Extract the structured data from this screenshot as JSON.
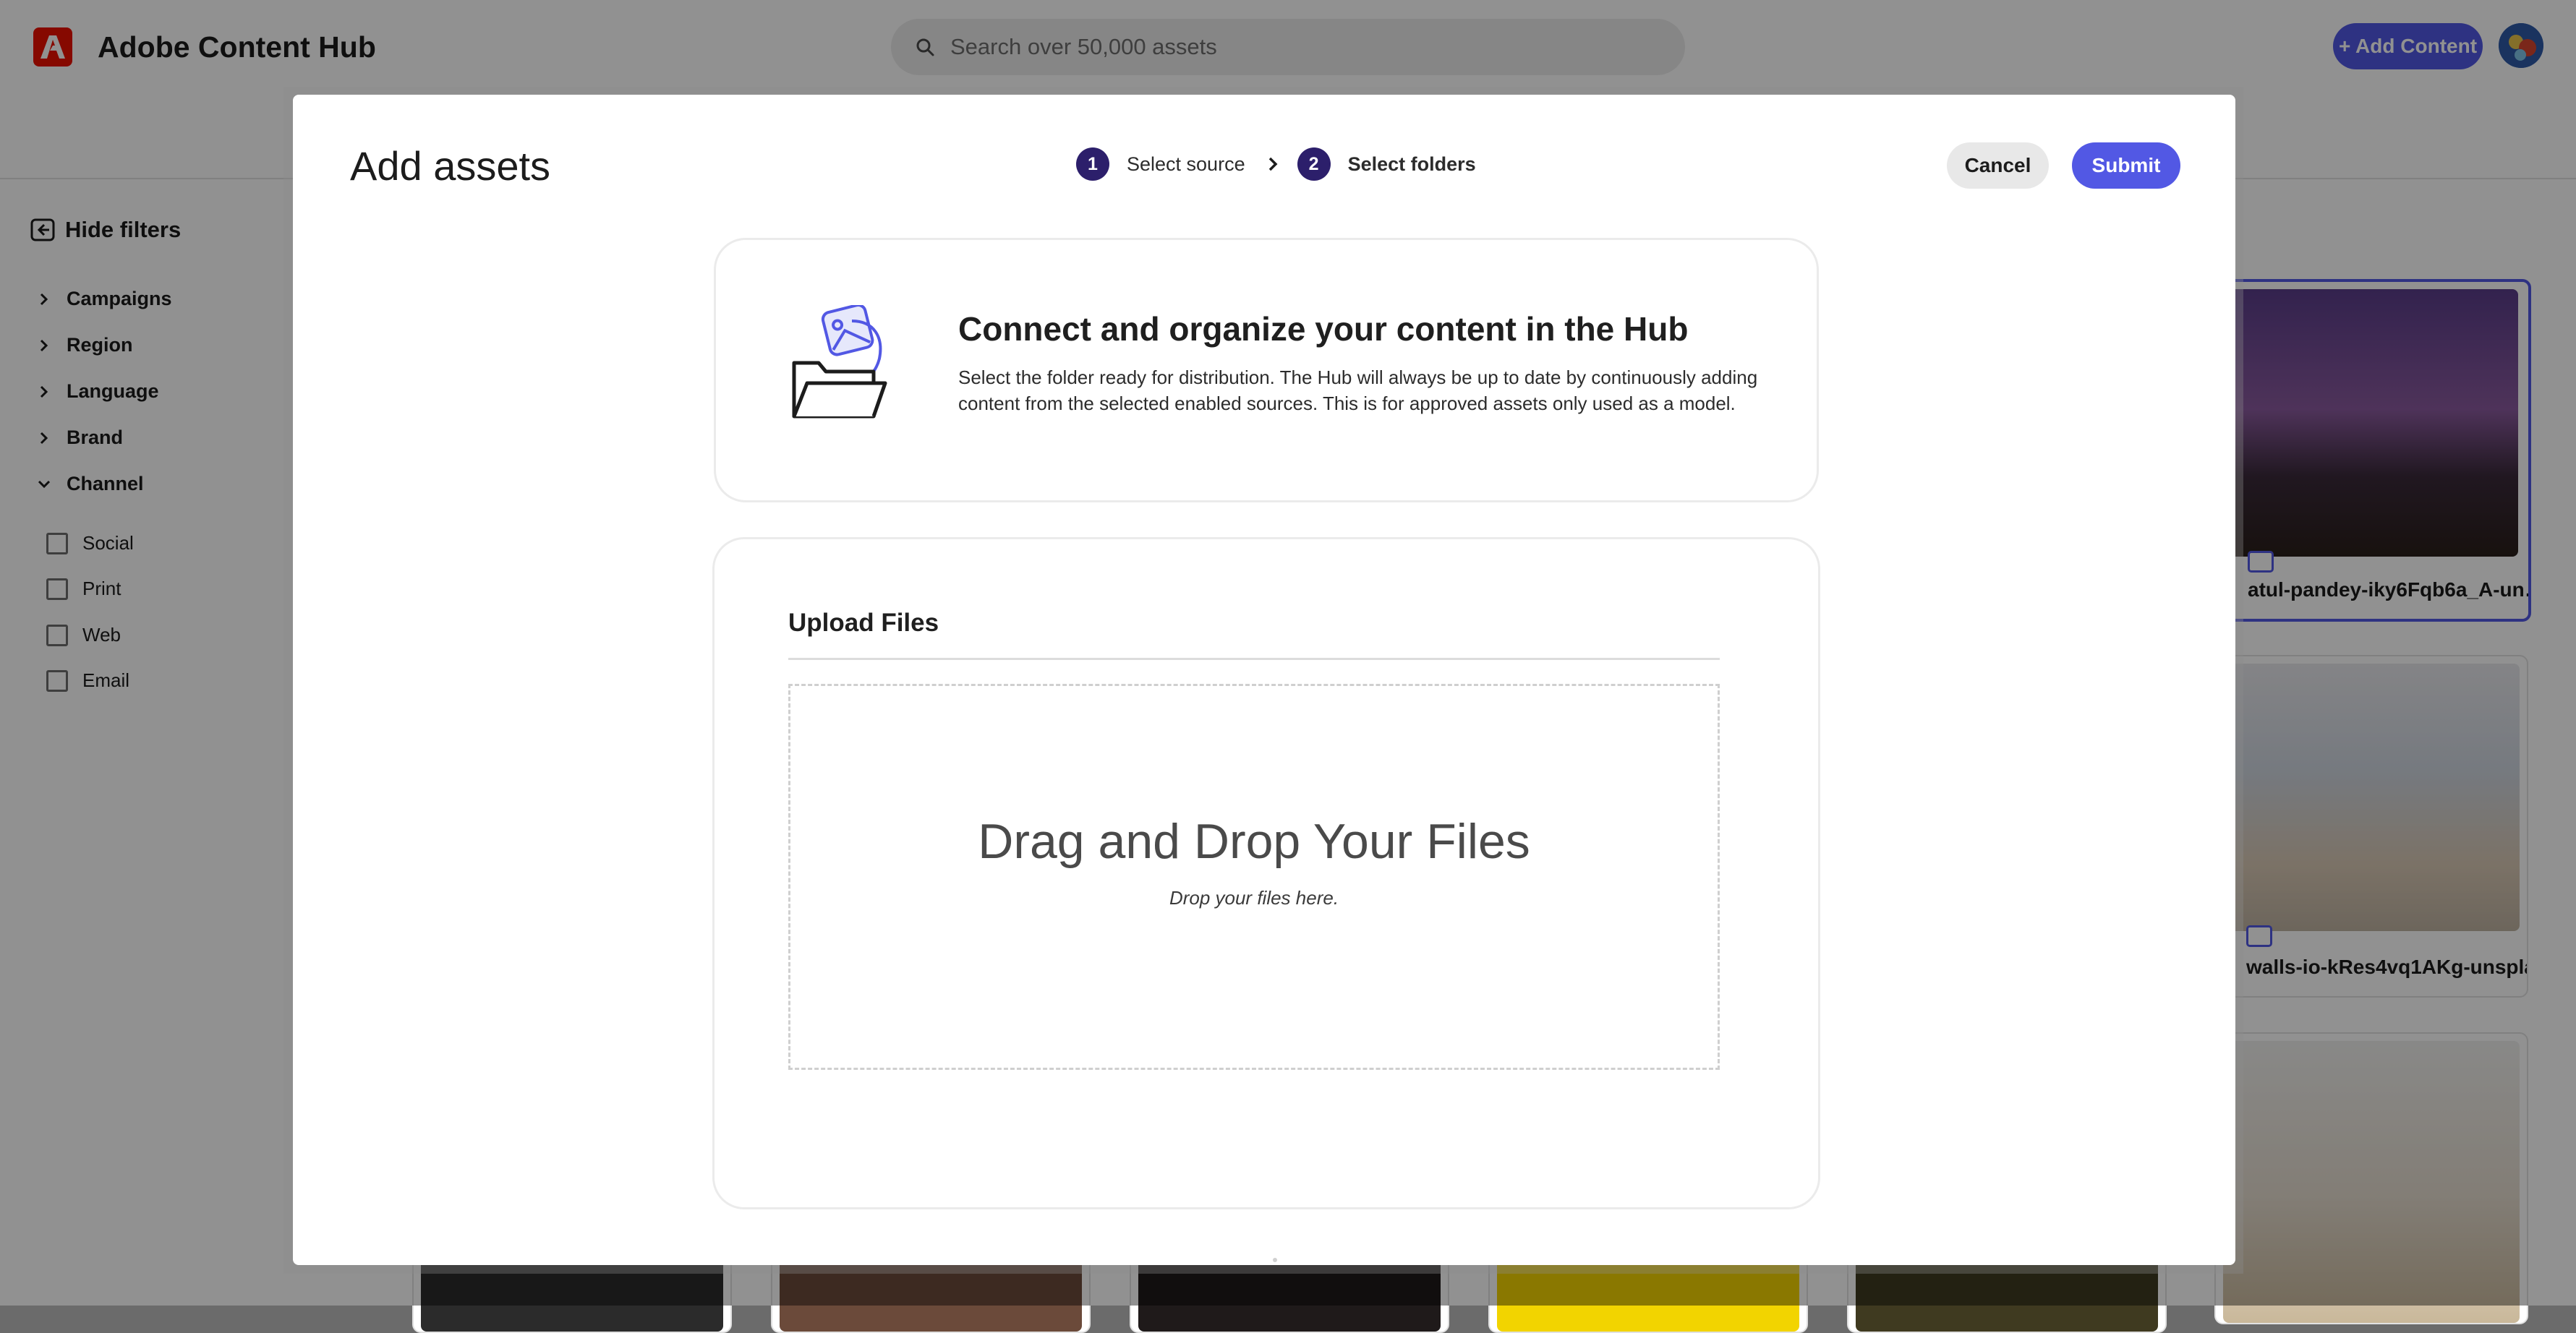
{
  "app": {
    "title": "Adobe Content Hub",
    "search_placeholder": "Search over 50,000 assets",
    "add_content_label": "+ Add Content",
    "accent_color": "#5258e4",
    "brand_color": "#eb1000"
  },
  "sidebar": {
    "hide_filters_label": "Hide filters",
    "facets": [
      {
        "label": "Campaigns",
        "expanded": false
      },
      {
        "label": "Region",
        "expanded": false
      },
      {
        "label": "Language",
        "expanded": false
      },
      {
        "label": "Brand",
        "expanded": false
      },
      {
        "label": "Channel",
        "expanded": true
      }
    ],
    "channel_options": [
      {
        "label": "Social",
        "checked": false
      },
      {
        "label": "Print",
        "checked": false
      },
      {
        "label": "Web",
        "checked": false
      },
      {
        "label": "Email",
        "checked": false
      }
    ]
  },
  "assets": [
    {
      "name": "atul-pandey-iky6Fqb6a_A-un…",
      "selected": true
    },
    {
      "name": "walls-io-kRes4vq1AKg-unspla…",
      "selected": false
    }
  ],
  "modal": {
    "title": "Add assets",
    "steps": [
      {
        "number": "1",
        "label": "Select source",
        "active": false
      },
      {
        "number": "2",
        "label": "Select folders",
        "active": true
      }
    ],
    "cancel_label": "Cancel",
    "submit_label": "Submit",
    "info": {
      "title": "Connect and organize your content in the Hub",
      "description": "Select the folder ready for distribution. The Hub will always be up to date by continuously adding content from the selected enabled sources. This is for approved assets only used as a model."
    },
    "upload": {
      "title": "Upload Files",
      "drop_title": "Drag and Drop Your Files",
      "drop_subtitle": "Drop your files here."
    }
  }
}
